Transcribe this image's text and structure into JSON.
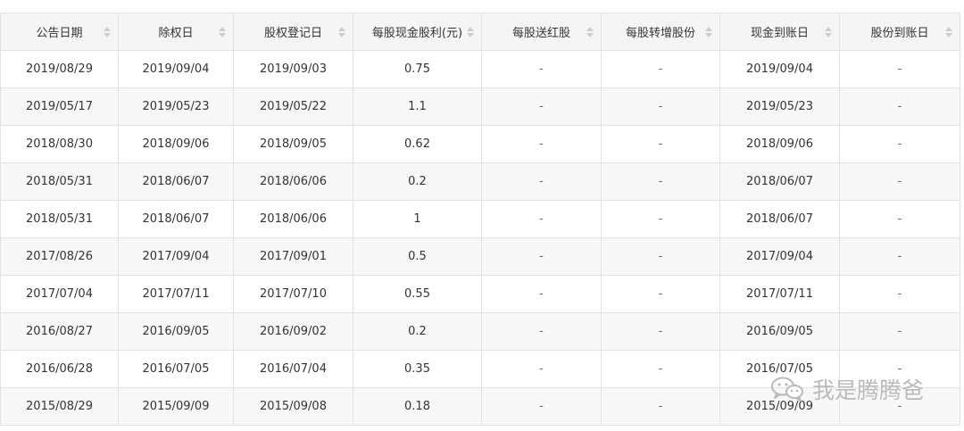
{
  "columns": [
    {
      "label": "公告日期"
    },
    {
      "label": "除权日"
    },
    {
      "label": "股权登记日"
    },
    {
      "label": "每股现金股利(元)"
    },
    {
      "label": "每股送红股"
    },
    {
      "label": "每股转增股份"
    },
    {
      "label": "现金到账日"
    },
    {
      "label": "股份到账日"
    }
  ],
  "rows": [
    [
      "2019/08/29",
      "2019/09/04",
      "2019/09/03",
      "0.75",
      "-",
      "-",
      "2019/09/04",
      "-"
    ],
    [
      "2019/05/17",
      "2019/05/23",
      "2019/05/22",
      "1.1",
      "-",
      "-",
      "2019/05/23",
      "-"
    ],
    [
      "2018/08/30",
      "2018/09/06",
      "2018/09/05",
      "0.62",
      "-",
      "-",
      "2018/09/06",
      "-"
    ],
    [
      "2018/05/31",
      "2018/06/07",
      "2018/06/06",
      "0.2",
      "-",
      "-",
      "2018/06/07",
      "-"
    ],
    [
      "2018/05/31",
      "2018/06/07",
      "2018/06/06",
      "1",
      "-",
      "-",
      "2018/06/07",
      "-"
    ],
    [
      "2017/08/26",
      "2017/09/04",
      "2017/09/01",
      "0.5",
      "-",
      "-",
      "2017/09/04",
      "-"
    ],
    [
      "2017/07/04",
      "2017/07/11",
      "2017/07/10",
      "0.55",
      "-",
      "-",
      "2017/07/11",
      "-"
    ],
    [
      "2016/08/27",
      "2016/09/05",
      "2016/09/02",
      "0.2",
      "-",
      "-",
      "2016/09/05",
      "-"
    ],
    [
      "2016/06/28",
      "2016/07/05",
      "2016/07/04",
      "0.35",
      "-",
      "-",
      "2016/07/05",
      "-"
    ],
    [
      "2015/08/29",
      "2015/09/09",
      "2015/09/08",
      "0.18",
      "-",
      "-",
      "2015/09/09",
      "-"
    ]
  ],
  "watermark": {
    "text": "我是腾腾爸",
    "icon": "wechat-icon"
  },
  "colors": {
    "header_bg": "#f5f5f5",
    "row_alt_bg": "#f7f7f7",
    "border": "#e2e2e2",
    "sort_icon": "#cccccc"
  }
}
